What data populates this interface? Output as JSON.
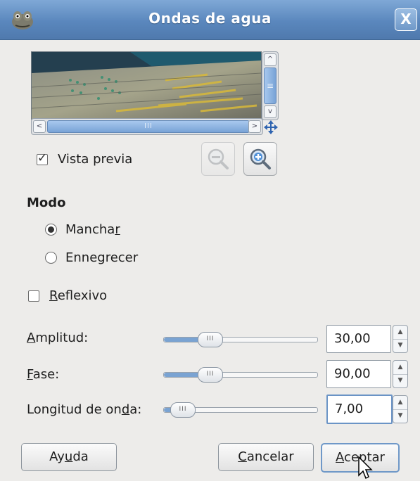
{
  "window": {
    "title": "Ondas de agua",
    "close_glyph": "X"
  },
  "preview": {
    "hscroll_thumb_glyph": "III",
    "vscroll_thumb_glyph": "≡",
    "preview_checkbox": {
      "label": "Vista previa",
      "checked": true
    }
  },
  "mode": {
    "title": "Modo",
    "options": [
      {
        "pre": "Mancha",
        "mnemonic": "r",
        "post": "",
        "selected": true
      },
      {
        "pre": "Ennegrecer",
        "mnemonic": "",
        "post": "",
        "selected": false
      }
    ]
  },
  "reflective": {
    "mnemonic": "R",
    "post": "eflexivo",
    "checked": false
  },
  "params": [
    {
      "pre": "",
      "mnemonic": "A",
      "post": "mplitud:",
      "value": "30,00",
      "fraction": 0.28
    },
    {
      "pre": "",
      "mnemonic": "F",
      "post": "ase:",
      "value": "90,00",
      "fraction": 0.28
    },
    {
      "pre": "Longitud de on",
      "mnemonic": "d",
      "post": "a:",
      "value": "7,00",
      "fraction": 0.1
    }
  ],
  "buttons": {
    "help": {
      "pre": "Ay",
      "mnemonic": "u",
      "post": "da"
    },
    "cancel": {
      "pre": "",
      "mnemonic": "C",
      "post": "ancelar"
    },
    "ok": {
      "pre": "",
      "mnemonic": "A",
      "post": "ceptar"
    }
  },
  "slider_knob_glyph": "III",
  "colors": {
    "titlebar": "#5a87bd",
    "accent": "#7aa3d2",
    "window_bg": "#edecea"
  }
}
